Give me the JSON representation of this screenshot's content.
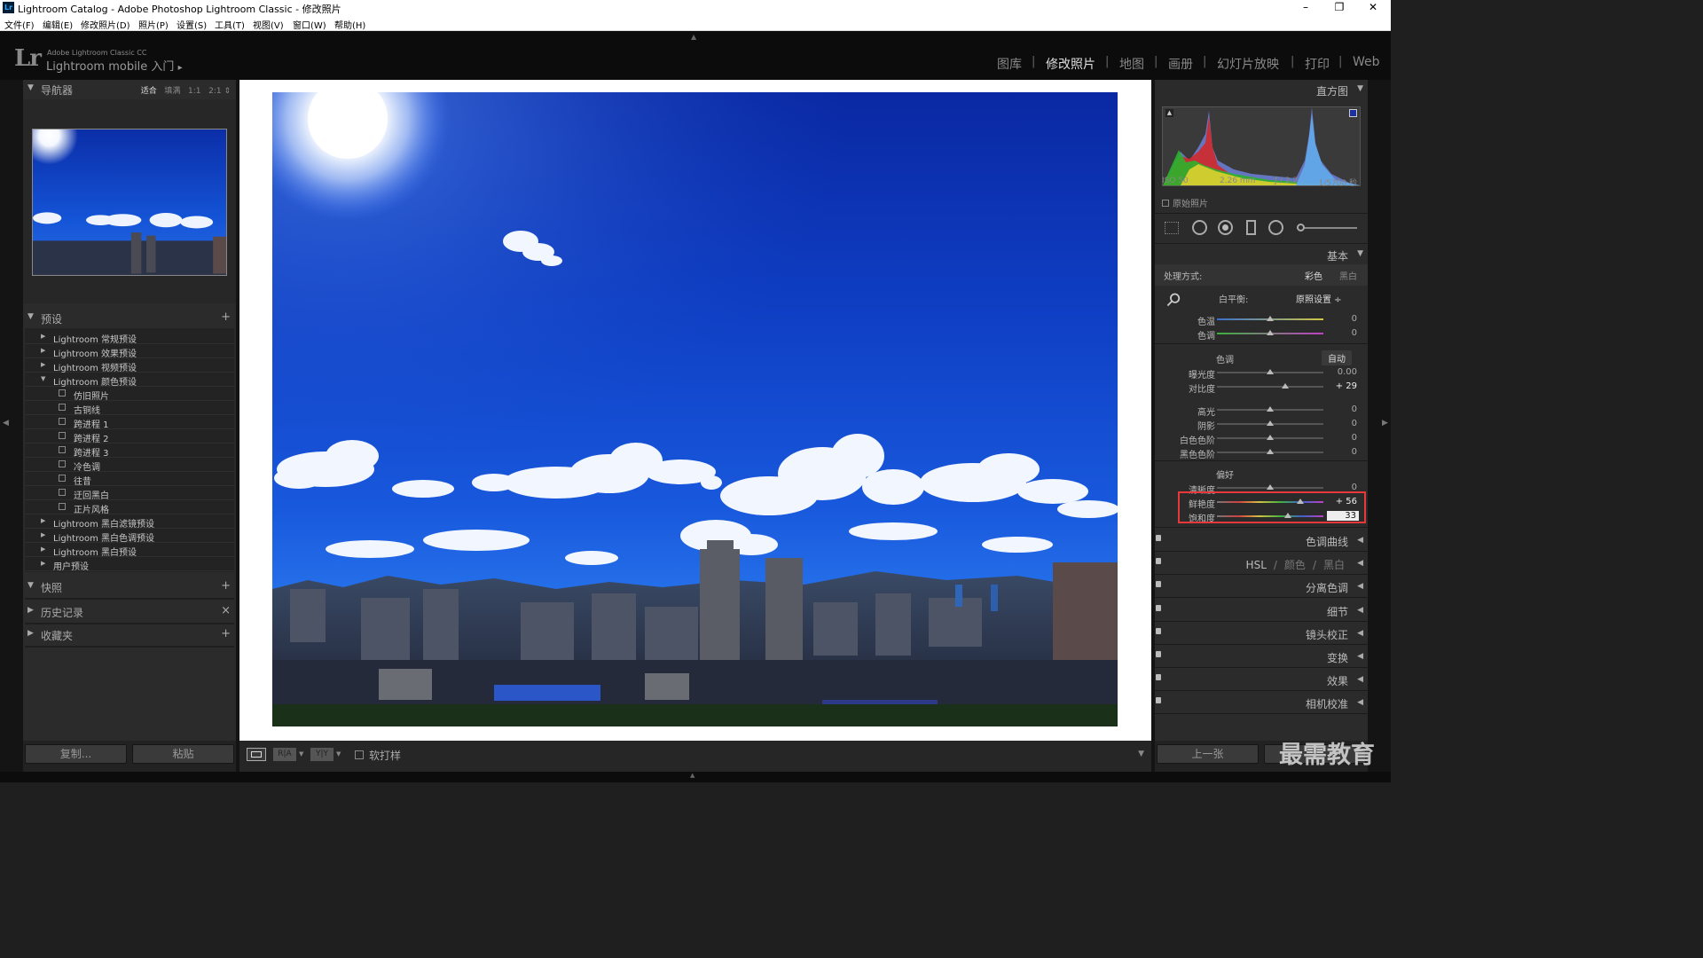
{
  "window": {
    "title": "Lightroom Catalog - Adobe Photoshop Lightroom Classic - 修改照片",
    "app_icon": "Lr",
    "minimize": "–",
    "maximize": "❐",
    "close": "✕"
  },
  "menu": [
    "文件(F)",
    "编辑(E)",
    "修改照片(D)",
    "照片(P)",
    "设置(S)",
    "工具(T)",
    "视图(V)",
    "窗口(W)",
    "帮助(H)"
  ],
  "identity": {
    "logo": "Lr",
    "product": "Adobe Lightroom Classic CC",
    "user": "Lightroom mobile 入门",
    "arrow": "▸"
  },
  "modules": [
    "图库",
    "修改照片",
    "地图",
    "画册",
    "幻灯片放映",
    "打印",
    "Web"
  ],
  "module_sep": "|",
  "left": {
    "navigator": {
      "title": "导航器",
      "options": [
        "适合",
        "填满",
        "1:1",
        "2:1"
      ],
      "active": "适合",
      "zoom_arrow": "⇕"
    },
    "presets": {
      "title": "预设",
      "add": "+",
      "items": [
        {
          "label": "Lightroom 常规预设",
          "level": 0,
          "arrow": "▶"
        },
        {
          "label": "Lightroom 效果预设",
          "level": 0,
          "arrow": "▶"
        },
        {
          "label": "Lightroom 视频预设",
          "level": 0,
          "arrow": "▶"
        },
        {
          "label": "Lightroom 颜色预设",
          "level": 0,
          "arrow": "▼"
        },
        {
          "label": "仿旧照片",
          "level": 1
        },
        {
          "label": "古铜线",
          "level": 1
        },
        {
          "label": "跨进程 1",
          "level": 1
        },
        {
          "label": "跨进程 2",
          "level": 1
        },
        {
          "label": "跨进程 3",
          "level": 1
        },
        {
          "label": "冷色调",
          "level": 1
        },
        {
          "label": "往昔",
          "level": 1
        },
        {
          "label": "迂回黑白",
          "level": 1
        },
        {
          "label": "正片风格",
          "level": 1
        },
        {
          "label": "Lightroom 黑白滤镜预设",
          "level": 0,
          "arrow": "▶"
        },
        {
          "label": "Lightroom 黑白色调预设",
          "level": 0,
          "arrow": "▶"
        },
        {
          "label": "Lightroom 黑白预设",
          "level": 0,
          "arrow": "▶"
        },
        {
          "label": "用户预设",
          "level": 0,
          "arrow": "▶"
        }
      ]
    },
    "snapshots": {
      "title": "快照",
      "add": "+"
    },
    "history": {
      "title": "历史记录",
      "clear": "×"
    },
    "collections": {
      "title": "收藏夹",
      "add": "+"
    },
    "copy_button": "复制...",
    "paste_button": "粘贴"
  },
  "right": {
    "histogram": {
      "title": "直方图",
      "iso": "ISO 50",
      "focal": "2.26 mm",
      "aperture": "ƒ / 2.2",
      "shutter": "1/5700 秒",
      "original_label": "原始照片"
    },
    "basic": {
      "title": "基本",
      "treatment_label": "处理方式:",
      "treatment_color": "彩色",
      "treatment_bw": "黑白",
      "wb_label": "白平衡:",
      "wb_value": "原照设置 ÷",
      "tone_label": "色调",
      "tone_auto": "自动",
      "presence_label": "偏好",
      "sliders": [
        {
          "key": "temp",
          "label": "色温",
          "value": "0",
          "pos": 0.5
        },
        {
          "key": "tint",
          "label": "色调",
          "value": "0",
          "pos": 0.5
        },
        {
          "key": "exposure",
          "label": "曝光度",
          "value": "0.00",
          "pos": 0.5
        },
        {
          "key": "contrast",
          "label": "对比度",
          "value": "+ 29",
          "pos": 0.645
        },
        {
          "key": "highlights",
          "label": "高光",
          "value": "0",
          "pos": 0.5
        },
        {
          "key": "shadows",
          "label": "阴影",
          "value": "0",
          "pos": 0.5
        },
        {
          "key": "whites",
          "label": "白色色阶",
          "value": "0",
          "pos": 0.5
        },
        {
          "key": "blacks",
          "label": "黑色色阶",
          "value": "0",
          "pos": 0.5
        },
        {
          "key": "clarity",
          "label": "清晰度",
          "value": "0",
          "pos": 0.5
        },
        {
          "key": "vibrance",
          "label": "鲜艳度",
          "value": "+ 56",
          "pos": 0.78
        },
        {
          "key": "saturation",
          "label": "饱和度",
          "value": "33",
          "pos": 0.665
        }
      ]
    },
    "sections": [
      "色调曲线",
      "HSL / 颜色 / 黑白",
      "分离色调",
      "细节",
      "镜头校正",
      "变换",
      "效果",
      "相机校准"
    ],
    "hsl_parts": [
      "HSL",
      "/",
      "颜色",
      "/",
      "黑白"
    ],
    "prev_button": "上一张",
    "watermark": "最需教育"
  },
  "toolbar": {
    "softproof_label": "软打样",
    "loupe_icon": "□",
    "compare_ra": "R|A",
    "compare_yy": "Y|Y"
  },
  "colors": {
    "highlight": "#e8383b",
    "sky": "#1347c9",
    "accent": "#ddd"
  }
}
